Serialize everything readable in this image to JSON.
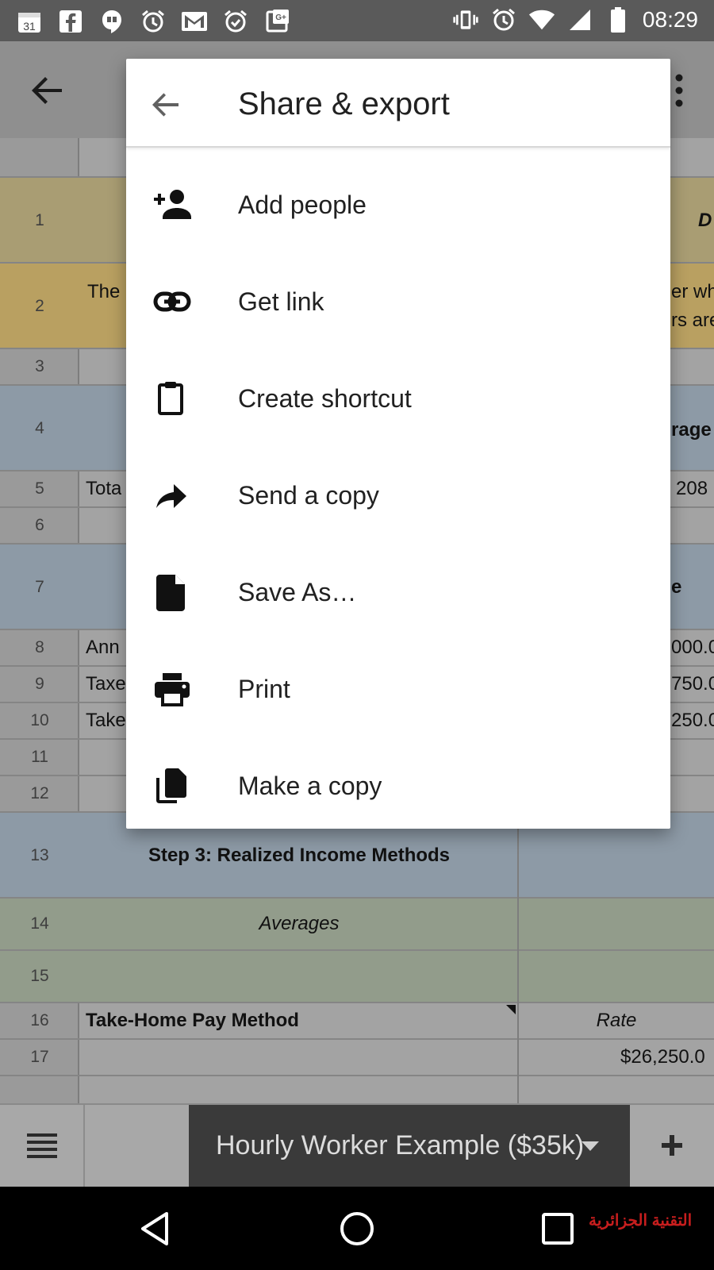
{
  "status_bar": {
    "calendar_day": "31",
    "time": "08:29"
  },
  "dialog": {
    "title": "Share & export",
    "items": [
      {
        "label": "Add people",
        "icon": "add-person-icon"
      },
      {
        "label": "Get link",
        "icon": "link-icon"
      },
      {
        "label": "Create shortcut",
        "icon": "clipboard-icon"
      },
      {
        "label": "Send a copy",
        "icon": "share-arrow-icon"
      },
      {
        "label": "Save As…",
        "icon": "file-icon"
      },
      {
        "label": "Print",
        "icon": "print-icon"
      },
      {
        "label": "Make a copy",
        "icon": "copy-icon"
      }
    ]
  },
  "sheet": {
    "row_numbers": [
      "1",
      "2",
      "3",
      "4",
      "5",
      "6",
      "7",
      "8",
      "9",
      "10",
      "11",
      "12",
      "13",
      "14",
      "15",
      "16",
      "17"
    ],
    "cells": {
      "r1_right": "D",
      "r2_left": "The",
      "r2_right_a": "er wh",
      "r2_right_b": "rs are",
      "r4_right": "rage",
      "r5_left": "Tota",
      "r5_right": "208",
      "r7_right": "e",
      "r8_left": "Ann",
      "r8_right": "000.0",
      "r9_left": "Taxe",
      "r9_right": "750.0",
      "r10_left": "Take",
      "r10_right": "250.0",
      "r13": "Step 3: Realized Income Methods",
      "r14": "Averages",
      "r16_left": "Take-Home Pay Method",
      "r16_right": "Rate",
      "r17_right": "$26,250.0"
    }
  },
  "tab_bar": {
    "sheet_tab": "Hourly Worker Example ($35k)"
  },
  "watermark": "التقنية الجزائرية"
}
